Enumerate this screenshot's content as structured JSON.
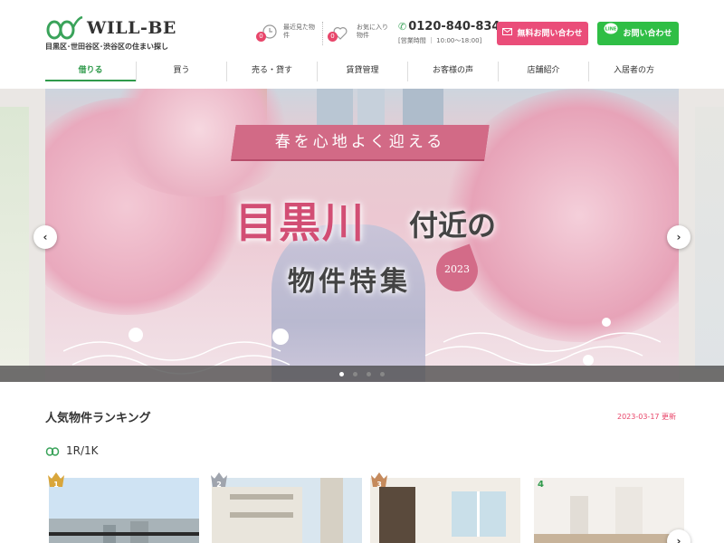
{
  "brand": {
    "name": "WILL-BE",
    "tagline": "目黒区･世田谷区･渋谷区の住まい探し",
    "accent_color": "#2f9a4b",
    "pink_color": "#ea4d79",
    "line_color": "#2fbe45"
  },
  "header": {
    "recently_viewed": {
      "label": "最近見た物件",
      "count": "0",
      "icon": "clock-icon"
    },
    "favorites": {
      "label": "お気に入り物件",
      "count": "0",
      "icon": "heart-icon"
    },
    "phone": "0120-840-834",
    "hours": "[営業時間 ｜ 10:00〜18:00]",
    "contact_button": "無料お問い合わせ",
    "line_button": "お問い合わせ"
  },
  "nav": {
    "items": [
      {
        "label": "借りる",
        "active": true
      },
      {
        "label": "買う"
      },
      {
        "label": "売る・貸す"
      },
      {
        "label": "賃貸管理"
      },
      {
        "label": "お客様の声"
      },
      {
        "label": "店舗紹介"
      },
      {
        "label": "入居者の方"
      }
    ]
  },
  "hero": {
    "ribbon": "春を心地よく迎える",
    "headline": "目黒川",
    "headline_rest": "付近の",
    "subline": "物件特集",
    "year": "2023",
    "slide_count": 4,
    "active_slide": 1
  },
  "ranking": {
    "title": "人気物件ランキング",
    "updated": "2023-03-17 更新",
    "category": "1R/1K",
    "items": [
      {
        "rank": "1",
        "crown": "gold-crown-icon"
      },
      {
        "rank": "2",
        "crown": "silver-crown-icon"
      },
      {
        "rank": "3",
        "crown": "bronze-crown-icon"
      },
      {
        "rank": "4"
      }
    ]
  }
}
